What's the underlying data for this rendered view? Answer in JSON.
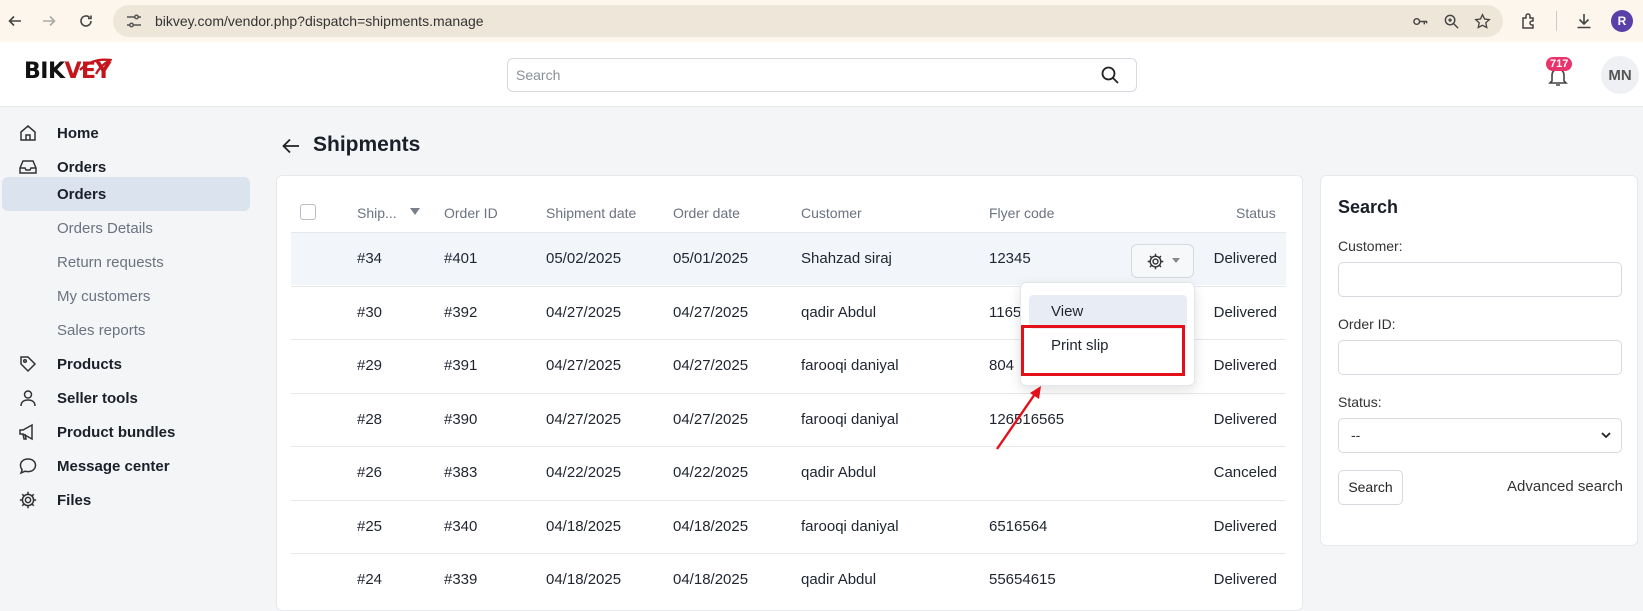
{
  "browser": {
    "url": "bikvey.com/vendor.php?dispatch=shipments.manage",
    "profile_initial": "R"
  },
  "header": {
    "logo_text_a": "BIK",
    "logo_text_b": "VEY",
    "search_placeholder": "Search",
    "notification_count": "717",
    "avatar_initials": "MN"
  },
  "sidebar": {
    "items": [
      {
        "label": "Home",
        "icon": "home-icon"
      },
      {
        "label": "Orders",
        "icon": "inbox-icon"
      },
      {
        "label": "Orders"
      },
      {
        "label": "Orders Details"
      },
      {
        "label": "Return requests"
      },
      {
        "label": "My customers"
      },
      {
        "label": "Sales reports"
      },
      {
        "label": "Products",
        "icon": "tag-icon"
      },
      {
        "label": "Seller tools",
        "icon": "user-icon"
      },
      {
        "label": "Product bundles",
        "icon": "megaphone-icon"
      },
      {
        "label": "Message center",
        "icon": "chat-icon"
      },
      {
        "label": "Files",
        "icon": "gear-icon"
      }
    ]
  },
  "page": {
    "title": "Shipments"
  },
  "table": {
    "columns": [
      "Ship...",
      "Order ID",
      "Shipment date",
      "Order date",
      "Customer",
      "Flyer code",
      "Status"
    ],
    "rows": [
      {
        "ship": "#34",
        "order": "#401",
        "ship_date": "05/02/2025",
        "order_date": "05/01/2025",
        "customer": "Shahzad siraj",
        "flyer": "12345",
        "status": "Delivered"
      },
      {
        "ship": "#30",
        "order": "#392",
        "ship_date": "04/27/2025",
        "order_date": "04/27/2025",
        "customer": "qadir Abdul",
        "flyer": "1165",
        "status": "Delivered"
      },
      {
        "ship": "#29",
        "order": "#391",
        "ship_date": "04/27/2025",
        "order_date": "04/27/2025",
        "customer": "farooqi daniyal",
        "flyer": "804",
        "status": "Delivered"
      },
      {
        "ship": "#28",
        "order": "#390",
        "ship_date": "04/27/2025",
        "order_date": "04/27/2025",
        "customer": "farooqi daniyal",
        "flyer": "126516565",
        "status": "Delivered"
      },
      {
        "ship": "#26",
        "order": "#383",
        "ship_date": "04/22/2025",
        "order_date": "04/22/2025",
        "customer": "qadir Abdul",
        "flyer": "",
        "status": "Canceled"
      },
      {
        "ship": "#25",
        "order": "#340",
        "ship_date": "04/18/2025",
        "order_date": "04/18/2025",
        "customer": "farooqi daniyal",
        "flyer": "6516564",
        "status": "Delivered"
      },
      {
        "ship": "#24",
        "order": "#339",
        "ship_date": "04/18/2025",
        "order_date": "04/18/2025",
        "customer": "qadir Abdul",
        "flyer": "55654615",
        "status": "Delivered"
      }
    ]
  },
  "actions_menu": {
    "items": [
      "View",
      "Print slip"
    ]
  },
  "search_panel": {
    "title": "Search",
    "customer_label": "Customer:",
    "order_id_label": "Order ID:",
    "status_label": "Status:",
    "status_value": "--",
    "search_button": "Search",
    "advanced_link": "Advanced search"
  },
  "colors": {
    "annotation_red": "#e3101a",
    "badge_pink": "#e8336b",
    "active_sidebar": "#dbe3ef"
  }
}
